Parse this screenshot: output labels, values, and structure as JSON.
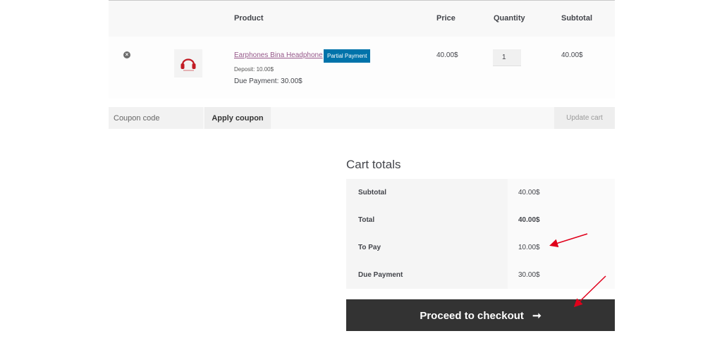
{
  "table": {
    "headers": {
      "product": "Product",
      "price": "Price",
      "quantity": "Quantity",
      "subtotal": "Subtotal"
    },
    "row": {
      "remove_icon": "×",
      "product_name": "Earphones Bina Headphone",
      "badge": "Partial Payment",
      "deposit": "Deposit: 10.00$",
      "due": "Due Payment: 30.00$",
      "price": "40.00$",
      "quantity": "1",
      "subtotal": "40.00$"
    }
  },
  "actions": {
    "coupon_placeholder": "Coupon code",
    "apply_label": "Apply coupon",
    "update_label": "Update cart"
  },
  "totals": {
    "title": "Cart totals",
    "rows": [
      {
        "label": "Subtotal",
        "value": "40.00$"
      },
      {
        "label": "Total",
        "value": "40.00$"
      },
      {
        "label": "To Pay",
        "value": "10.00$"
      },
      {
        "label": "Due Payment",
        "value": "30.00$"
      }
    ],
    "checkout_label": "Proceed to checkout",
    "checkout_arrow": "➞"
  },
  "colors": {
    "link": "#96588a",
    "badge": "#0073aa",
    "checkout": "#333333",
    "annotation": "#e0001b"
  }
}
